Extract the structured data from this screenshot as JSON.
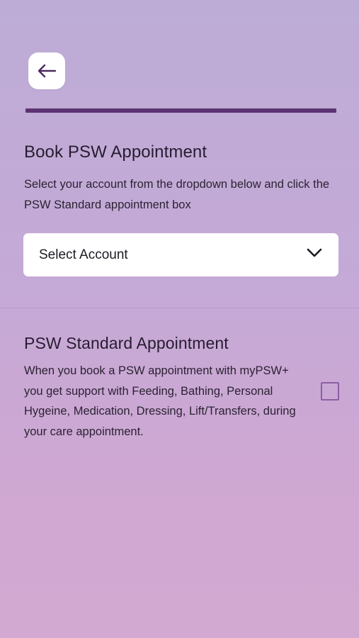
{
  "header": {
    "back_icon": "arrow-left-icon",
    "progress_color": "#5e3274"
  },
  "booking": {
    "title": "Book PSW Appointment",
    "instructions": "Select your account from the dropdown below and click the PSW Standard appointment box",
    "account_select": {
      "label": "Select Account",
      "icon": "chevron-down-icon"
    }
  },
  "standard_appointment": {
    "title": "PSW Standard Appointment",
    "description": "When you book a PSW appointment with myPSW+ you get support with Feeding, Bathing, Personal Hygeine, Medication, Dressing, Lift/Transfers, during your care appointment.",
    "checked": false
  },
  "colors": {
    "accent": "#5e3274",
    "checkbox_border": "#8b5fa3"
  }
}
